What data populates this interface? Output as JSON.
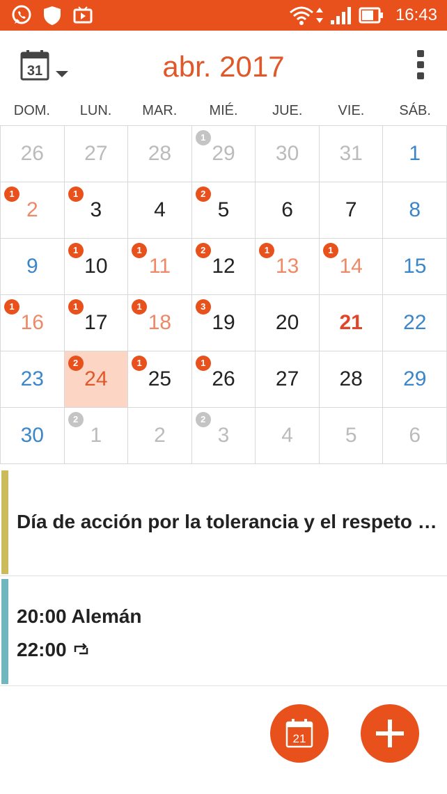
{
  "status_bar": {
    "time": "16:43",
    "icons": [
      "whatsapp-icon",
      "shield-icon",
      "video-icon",
      "wifi-icon",
      "data-arrows-icon",
      "signal-icon",
      "battery-icon"
    ]
  },
  "header": {
    "month_title": "abr. 2017",
    "calendar_icon_day": "31",
    "accent_color": "#e8501c"
  },
  "weekdays": [
    "DOM.",
    "LUN.",
    "MAR.",
    "MIÉ.",
    "JUE.",
    "VIE.",
    "SÁB."
  ],
  "weeks": [
    [
      {
        "day": "26",
        "style": "gray",
        "badge": ""
      },
      {
        "day": "27",
        "style": "gray",
        "badge": ""
      },
      {
        "day": "28",
        "style": "gray",
        "badge": ""
      },
      {
        "day": "29",
        "style": "gray",
        "badge": "1",
        "badge_style": "gray"
      },
      {
        "day": "30",
        "style": "gray",
        "badge": ""
      },
      {
        "day": "31",
        "style": "gray",
        "badge": ""
      },
      {
        "day": "1",
        "style": "blue",
        "badge": ""
      }
    ],
    [
      {
        "day": "2",
        "style": "salmon",
        "badge": "1"
      },
      {
        "day": "3",
        "style": "normal",
        "badge": "1"
      },
      {
        "day": "4",
        "style": "normal",
        "badge": ""
      },
      {
        "day": "5",
        "style": "normal",
        "badge": "2"
      },
      {
        "day": "6",
        "style": "normal",
        "badge": ""
      },
      {
        "day": "7",
        "style": "normal",
        "badge": ""
      },
      {
        "day": "8",
        "style": "blue",
        "badge": ""
      }
    ],
    [
      {
        "day": "9",
        "style": "blue",
        "badge": ""
      },
      {
        "day": "10",
        "style": "normal",
        "badge": "1"
      },
      {
        "day": "11",
        "style": "salmon",
        "badge": "1"
      },
      {
        "day": "12",
        "style": "normal",
        "badge": "2"
      },
      {
        "day": "13",
        "style": "salmon",
        "badge": "1"
      },
      {
        "day": "14",
        "style": "salmon",
        "badge": "1"
      },
      {
        "day": "15",
        "style": "blue",
        "badge": ""
      }
    ],
    [
      {
        "day": "16",
        "style": "salmon",
        "badge": "1"
      },
      {
        "day": "17",
        "style": "normal",
        "badge": "1"
      },
      {
        "day": "18",
        "style": "salmon",
        "badge": "1"
      },
      {
        "day": "19",
        "style": "normal",
        "badge": "3"
      },
      {
        "day": "20",
        "style": "normal",
        "badge": ""
      },
      {
        "day": "21",
        "style": "today",
        "badge": ""
      },
      {
        "day": "22",
        "style": "blue",
        "badge": ""
      }
    ],
    [
      {
        "day": "23",
        "style": "blue",
        "badge": ""
      },
      {
        "day": "24",
        "style": "selected",
        "badge": "2"
      },
      {
        "day": "25",
        "style": "normal",
        "badge": "1"
      },
      {
        "day": "26",
        "style": "normal",
        "badge": "1"
      },
      {
        "day": "27",
        "style": "normal",
        "badge": ""
      },
      {
        "day": "28",
        "style": "normal",
        "badge": ""
      },
      {
        "day": "29",
        "style": "blue",
        "badge": ""
      }
    ],
    [
      {
        "day": "30",
        "style": "blue",
        "badge": ""
      },
      {
        "day": "1",
        "style": "gray",
        "badge": "2",
        "badge_style": "gray"
      },
      {
        "day": "2",
        "style": "gray",
        "badge": ""
      },
      {
        "day": "3",
        "style": "gray",
        "badge": "2",
        "badge_style": "gray"
      },
      {
        "day": "4",
        "style": "gray",
        "badge": ""
      },
      {
        "day": "5",
        "style": "gray",
        "badge": ""
      },
      {
        "day": "6",
        "style": "gray",
        "badge": ""
      }
    ]
  ],
  "events": [
    {
      "title": "Día de acción por la tolerancia y el respeto entre los pueblos",
      "color": "#cbbb5c"
    },
    {
      "time_start": "20:00",
      "title": "Alemán",
      "time_end": "22:00",
      "color": "#6fb6be"
    }
  ],
  "fab_today_day": "21",
  "colors": {
    "weekend_blue": "#3a86c8",
    "event_salmon": "#ee8866",
    "selected_bg": "#fdd5c4"
  }
}
